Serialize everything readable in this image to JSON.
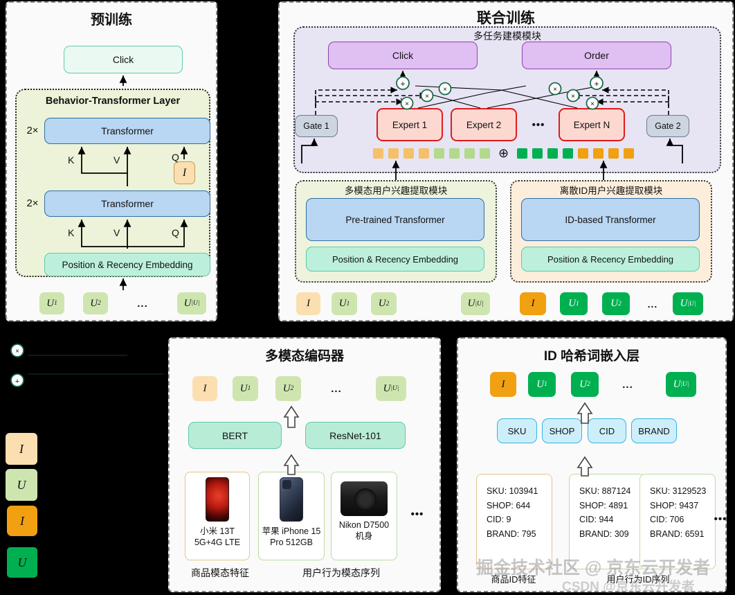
{
  "pretrain": {
    "title": "预训练",
    "click_label": "Click",
    "layer_title": "Behavior-Transformer Layer",
    "repeat_top": "2×",
    "repeat_bottom": "2×",
    "transformer_top": "Transformer",
    "transformer_bottom": "Transformer",
    "embedding": "Position & Recency Embedding",
    "item_token": "I",
    "kvq_top": {
      "k": "K",
      "v": "V",
      "q": "Q"
    },
    "kvq_bottom": {
      "k": "K",
      "v": "V",
      "q": "Q"
    },
    "tokens": [
      {
        "base": "U",
        "sub": "1"
      },
      {
        "base": "U",
        "sub": "2"
      },
      {
        "base": "U",
        "sub": "|U|"
      }
    ],
    "ellipsis": "..."
  },
  "joint": {
    "title": "联合训练",
    "mtl_module_title": "多任务建模模块",
    "tasks": [
      {
        "label": "Click"
      },
      {
        "label": "Order"
      }
    ],
    "gates": [
      {
        "label": "Gate 1"
      },
      {
        "label": "Gate 2"
      }
    ],
    "experts": [
      {
        "label": "Expert 1"
      },
      {
        "label": "Expert 2"
      },
      {
        "label": "Expert N"
      }
    ],
    "experts_ellipsis": "•••",
    "concat_symbol": "⊕",
    "plus_symbol": "+",
    "times_symbol": "×",
    "concat_chips": {
      "left_orange": 4,
      "left_green": 4,
      "right_green": 4,
      "right_orange": 4,
      "colors": {
        "left_orange": "#f5c06a",
        "left_green": "#b3d98c",
        "right_green": "#00b050",
        "right_orange": "#f0a011"
      }
    },
    "mm_module": {
      "title": "多模态用户兴趣提取模块",
      "transformer": "Pre-trained Transformer",
      "embedding": "Position & Recency Embedding",
      "tokens": [
        {
          "base": "I",
          "sub": ""
        },
        {
          "base": "U",
          "sub": "1"
        },
        {
          "base": "U",
          "sub": "2"
        },
        {
          "base": "U",
          "sub": "|U|"
        }
      ]
    },
    "id_module": {
      "title": "离散ID用户兴趣提取模块",
      "transformer": "ID-based Transformer",
      "embedding": "Position & Recency Embedding",
      "tokens": [
        {
          "base": "I",
          "sub": ""
        },
        {
          "base": "U",
          "sub": "1"
        },
        {
          "base": "U",
          "sub": "2"
        },
        {
          "base": "U",
          "sub": "|U|"
        }
      ],
      "ellipsis": "..."
    }
  },
  "legend": {
    "multiply_symbol": "×",
    "add_symbol": "+",
    "swatches": [
      {
        "glyph": "I",
        "kind": "item-multimodal"
      },
      {
        "glyph": "U",
        "kind": "user-multimodal"
      },
      {
        "glyph": "I",
        "kind": "item-id"
      },
      {
        "glyph": "U",
        "kind": "user-id"
      }
    ]
  },
  "encoder": {
    "title": "多模态编码器",
    "tokens": [
      {
        "base": "I",
        "sub": ""
      },
      {
        "base": "U",
        "sub": "1"
      },
      {
        "base": "U",
        "sub": "2"
      },
      {
        "base": "U",
        "sub": "|U|"
      }
    ],
    "ellipsis": "...",
    "models": [
      {
        "label": "BERT"
      },
      {
        "label": "ResNet-101"
      }
    ],
    "products": [
      {
        "name": "小米 13T 5G+4G LTE",
        "kind": "phone-red"
      },
      {
        "name": "苹果 iPhone 15 Pro 512GB",
        "kind": "phone-blue"
      },
      {
        "name": "Nikon D7500 机身",
        "kind": "camera"
      }
    ],
    "products_ellipsis": "•••",
    "caption_left": "商品模态特征",
    "caption_right": "用户行为模态序列"
  },
  "hashing": {
    "title": "ID 哈希词嵌入层",
    "tokens": [
      {
        "base": "I",
        "sub": ""
      },
      {
        "base": "U",
        "sub": "1"
      },
      {
        "base": "U",
        "sub": "2"
      },
      {
        "base": "U",
        "sub": "|U|"
      }
    ],
    "ellipsis": "...",
    "fields": [
      {
        "label": "SKU"
      },
      {
        "label": "SHOP"
      },
      {
        "label": "CID"
      },
      {
        "label": "BRAND"
      }
    ],
    "records": [
      {
        "sku": "SKU: 103941",
        "shop": "SHOP: 644",
        "cid": "CID: 9",
        "brand": "BRAND: 795"
      },
      {
        "sku": "SKU: 887124",
        "shop": "SHOP: 4891",
        "cid": "CID: 944",
        "brand": "BRAND: 309"
      },
      {
        "sku": "SKU: 3129523",
        "shop": "SHOP: 9437",
        "cid": "CID: 706",
        "brand": "BRAND: 6591"
      }
    ],
    "records_ellipsis": "•••",
    "caption_left": "商品ID特征",
    "caption_right": "用户行为ID序列"
  },
  "watermarks": [
    {
      "text": "掘金技术社区 @ 京东云开发者"
    },
    {
      "text": "CSDN @京东云开发者"
    }
  ]
}
